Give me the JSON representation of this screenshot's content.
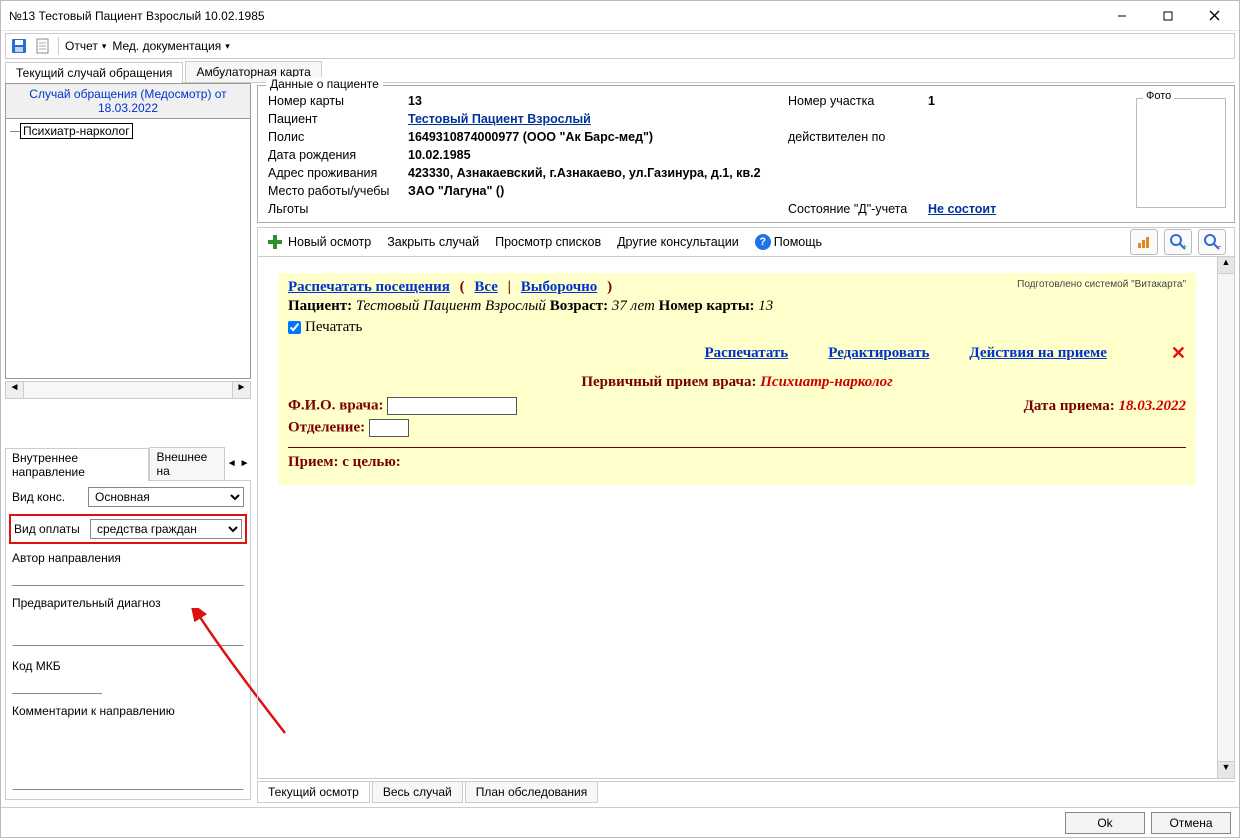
{
  "window": {
    "title": "№13 Тестовый Пациент Взрослый 10.02.1985"
  },
  "toolbar1": {
    "report": "Отчет",
    "meddoc": "Мед. документация"
  },
  "main_tabs": {
    "current": "Текущий случай обращения",
    "amb": "Амбулаторная карта"
  },
  "case_header": "Случай обращения (Медосмотр) от 18.03.2022",
  "tree": {
    "item0": "Психиатр-нарколог"
  },
  "ref_tabs": {
    "int": "Внутреннее направление",
    "ext": "Внешнее на"
  },
  "ref_form": {
    "cons_label": "Вид конс.",
    "cons_value": "Основная",
    "pay_label": "Вид оплаты",
    "pay_value": "средства граждан",
    "author_label": "Автор направления",
    "prelim_label": "Предварительный диагноз",
    "mkb_label": "Код МКБ",
    "comment_label": "Комментарии к направлению"
  },
  "patient_box": {
    "legend": "Данные о пациенте",
    "card_no_l": "Номер карты",
    "card_no": "13",
    "site_l": "Номер участка",
    "site": "1",
    "pat_l": "Пациент",
    "pat": "Тестовый Пациент Взрослый",
    "polis_l": "Полис",
    "polis": " 1649310874000977 (ООО \"Ак Барс-мед\")",
    "valid_l": "действителен по",
    "dob_l": "Дата рождения",
    "dob": "10.02.1985",
    "addr_l": "Адрес проживания",
    "addr": "423330, Азнакаевский, г.Азнакаево, ул.Газинура, д.1, кв.2",
    "work_l": "Место работы/учебы",
    "work": "ЗАО \"Лагуна\" ()",
    "priv_l": "Льготы",
    "dstat_l": "Состояние \"Д\"-учета",
    "dstat": "Не состоит",
    "photo": "Фото"
  },
  "toolbar2": {
    "new": "Новый осмотр",
    "close": "Закрыть случай",
    "lists": "Просмотр списков",
    "consult": "Другие консультации",
    "help": "Помощь"
  },
  "doc": {
    "print_visits": "Распечатать посещения",
    "all": "Все",
    "selective": "Выборочно",
    "system_note": "Подготовлено системой \"Витакарта\"",
    "pat_label": "Пациент:",
    "pat_name": "Тестовый Пациент Взрослый",
    "age_label": "Возраст:",
    "age_val": "37 лет",
    "card_label": "Номер карты:",
    "card_val": "13",
    "print_chk": "Печатать",
    "print_link": "Распечатать",
    "edit_link": "Редактировать",
    "actions_link": "Действия на приеме",
    "primary_l": "Первичный прием врача:",
    "primary_v": "Психиатр-нарколог",
    "fio_l": "Ф.И.О. врача:",
    "date_l": "Дата приема:",
    "date_v": "18.03.2022",
    "dept_l": "Отделение:",
    "purpose_l": "Прием: с целью:"
  },
  "bottom_tabs": {
    "current": "Текущий осмотр",
    "whole": "Весь случай",
    "plan": "План обследования"
  },
  "footer": {
    "ok": "Ok",
    "cancel": "Отмена"
  }
}
